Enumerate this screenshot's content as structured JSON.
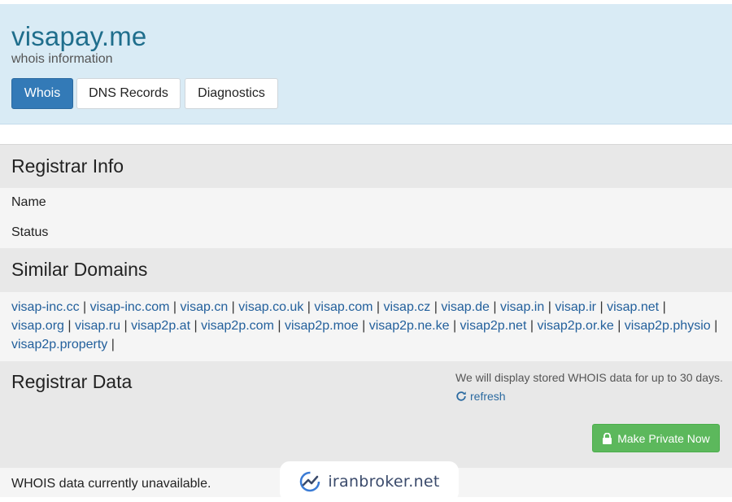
{
  "header": {
    "title": "visapay.me",
    "subtitle": "whois information",
    "tabs": [
      {
        "label": "Whois",
        "active": true
      },
      {
        "label": "DNS Records",
        "active": false
      },
      {
        "label": "Diagnostics",
        "active": false
      }
    ]
  },
  "registrar_info": {
    "heading": "Registrar Info",
    "rows": [
      "Name",
      "Status"
    ]
  },
  "similar_domains": {
    "heading": "Similar Domains",
    "separator": "|",
    "domains": [
      "visap-inc.cc",
      "visap-inc.com",
      "visap.cn",
      "visap.co.uk",
      "visap.com",
      "visap.cz",
      "visap.de",
      "visap.in",
      "visap.ir",
      "visap.net",
      "visap.org",
      "visap.ru",
      "visap2p.at",
      "visap2p.com",
      "visap2p.moe",
      "visap2p.ne.ke",
      "visap2p.net",
      "visap2p.or.ke",
      "visap2p.physio",
      "visap2p.property"
    ]
  },
  "registrar_data": {
    "heading": "Registrar Data",
    "note": "We will display stored WHOIS data for up to 30 days.",
    "refresh_label": "refresh",
    "private_button": "Make Private Now",
    "unavailable": "WHOIS data currently unavailable."
  },
  "watermark": {
    "text": "iranbroker.net"
  },
  "colors": {
    "header_bg": "#d9ebf5",
    "title": "#1f6e8c",
    "active_tab": "#337ab7",
    "link": "#23609c",
    "private_button": "#5cb85c"
  },
  "icons": {
    "refresh": "refresh-icon",
    "lock": "lock-icon",
    "watermark_logo": "chart-trend-icon"
  }
}
